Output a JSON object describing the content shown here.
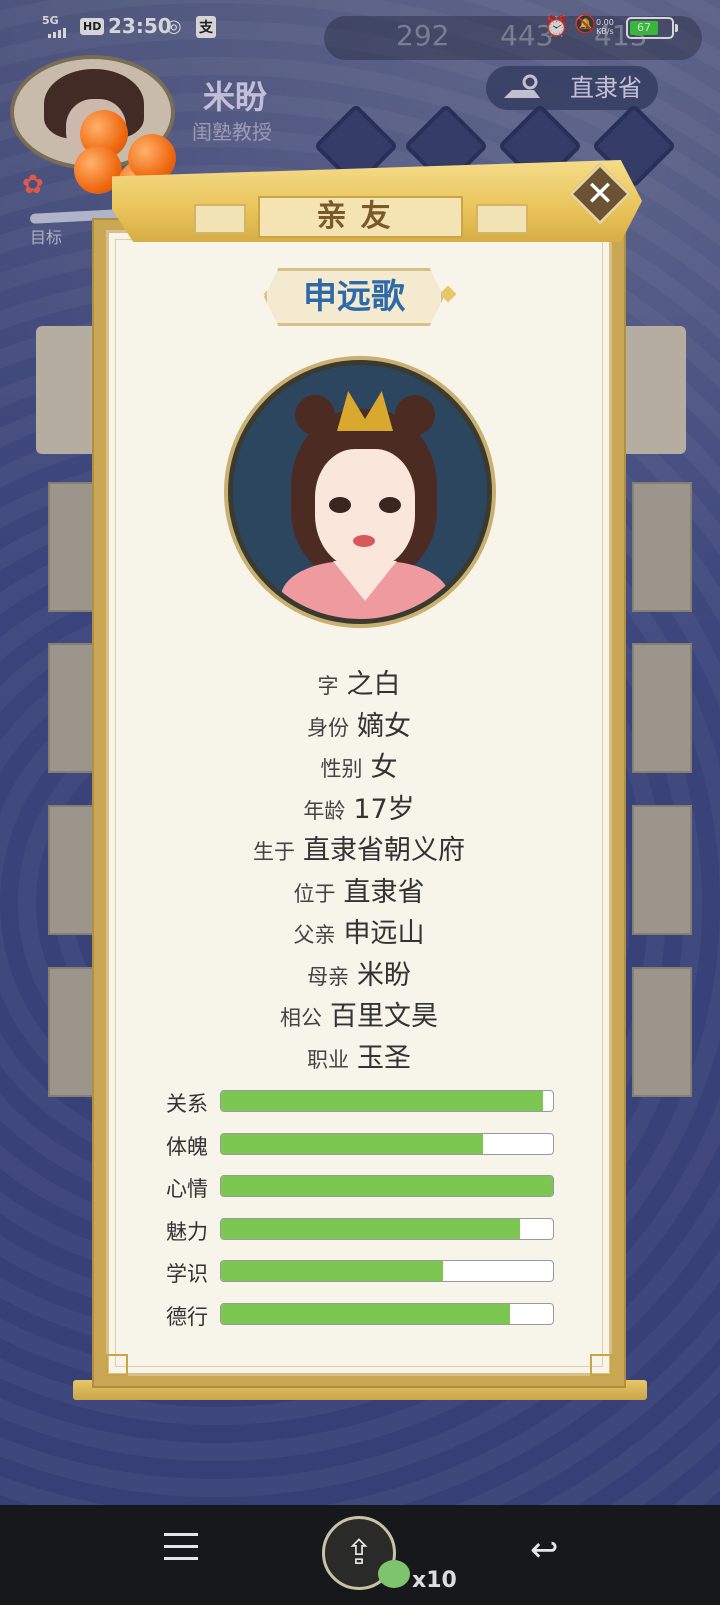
{
  "status_bar": {
    "network": "5G",
    "hd": "HD",
    "time": "23:50",
    "pay_icon_text": "支",
    "speed_value": "0.00",
    "speed_unit": "KB/s",
    "battery": "67"
  },
  "background": {
    "player_name": "米盼",
    "player_title": "闺塾教授",
    "goal_label": "目标",
    "region": "直隶省",
    "currency": [
      "292",
      "443",
      "413"
    ]
  },
  "dialog": {
    "title": "亲友",
    "close_icon": "✕",
    "person_name": "申远歌",
    "info": [
      {
        "key": "字",
        "value": "之白"
      },
      {
        "key": "身份",
        "value": "嫡女"
      },
      {
        "key": "性别",
        "value": "女"
      },
      {
        "key": "年龄",
        "value": "17岁"
      },
      {
        "key": "生于",
        "value": "直隶省朝义府"
      },
      {
        "key": "位于",
        "value": "直隶省"
      },
      {
        "key": "父亲",
        "value": "申远山"
      },
      {
        "key": "母亲",
        "value": "米盼"
      },
      {
        "key": "相公",
        "value": "百里文昊"
      },
      {
        "key": "职业",
        "value": "玉圣"
      }
    ],
    "stats": [
      {
        "label": "关系",
        "percent": 97
      },
      {
        "label": "体魄",
        "percent": 79
      },
      {
        "label": "心情",
        "percent": 100
      },
      {
        "label": "魅力",
        "percent": 90
      },
      {
        "label": "学识",
        "percent": 67
      },
      {
        "label": "德行",
        "percent": 87
      }
    ],
    "bar_color": "#7cc652"
  },
  "nav": {
    "badge": "x10"
  }
}
